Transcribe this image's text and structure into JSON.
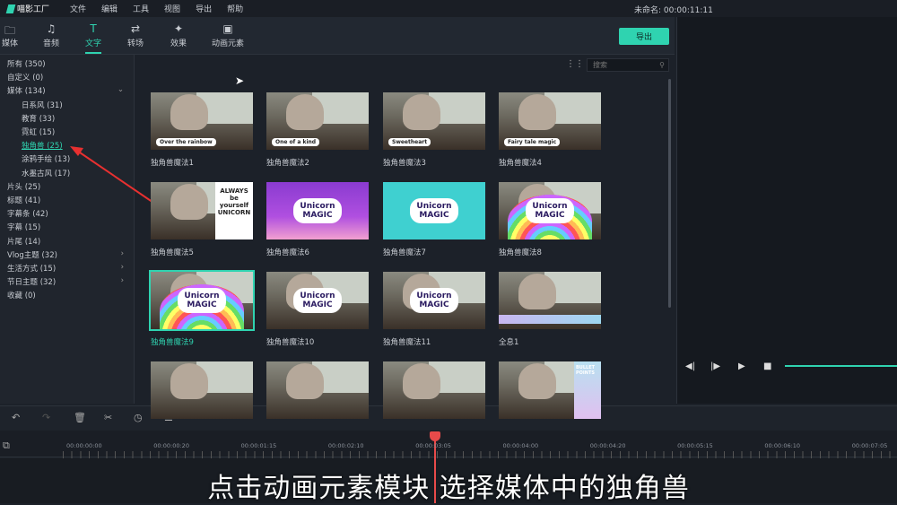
{
  "app": {
    "logo": "喵影工厂",
    "menus": [
      "文件",
      "编辑",
      "工具",
      "视图",
      "导出",
      "帮助"
    ],
    "project": "未命名:",
    "timecode": "00:00:11:11"
  },
  "tabs": [
    {
      "label": "媒体",
      "icon": "folder-icon"
    },
    {
      "label": "音频",
      "icon": "music-icon"
    },
    {
      "label": "文字",
      "icon": "text-icon",
      "active": true
    },
    {
      "label": "转场",
      "icon": "transition-icon"
    },
    {
      "label": "效果",
      "icon": "effects-icon"
    },
    {
      "label": "动画元素",
      "icon": "image-icon"
    }
  ],
  "export_label": "导出",
  "search": {
    "placeholder": "搜索"
  },
  "categories": [
    {
      "label": "所有 (350)"
    },
    {
      "label": "自定义 (0)"
    },
    {
      "label": "媒体 (134)",
      "chevron": "down"
    },
    {
      "label": "日系风 (31)",
      "sub": true
    },
    {
      "label": "教育 (33)",
      "sub": true
    },
    {
      "label": "霓虹 (15)",
      "sub": true
    },
    {
      "label": "独角兽 (25)",
      "sub": true,
      "selected": true
    },
    {
      "label": "涂鸦手绘 (13)",
      "sub": true
    },
    {
      "label": "水墨古风 (17)",
      "sub": true
    },
    {
      "label": "片头 (25)"
    },
    {
      "label": "标题 (41)"
    },
    {
      "label": "字幕条 (42)"
    },
    {
      "label": "字幕 (15)"
    },
    {
      "label": "片尾 (14)"
    },
    {
      "label": "Vlog主题 (32)",
      "chevron": "right"
    },
    {
      "label": "生活方式 (15)",
      "chevron": "right"
    },
    {
      "label": "节日主题 (32)",
      "chevron": "right"
    },
    {
      "label": "收藏 (0)"
    }
  ],
  "items": [
    {
      "label": "独角兽魔法1",
      "overlay": "Over the rainbow"
    },
    {
      "label": "独角兽魔法2",
      "overlay": "One of a kind"
    },
    {
      "label": "独角兽魔法3",
      "overlay": "Sweetheart"
    },
    {
      "label": "独角兽魔法4",
      "overlay": "Fairy tale magic"
    },
    {
      "label": "独角兽魔法5",
      "overlay": "ALWAYS be yourself UNICORN"
    },
    {
      "label": "独角兽魔法6",
      "overlay": "Unicorn MAGIC"
    },
    {
      "label": "独角兽魔法7",
      "overlay": "Unicorn MAGIC"
    },
    {
      "label": "独角兽魔法8",
      "overlay": "Unicorn MAGIC"
    },
    {
      "label": "独角兽魔法9",
      "overlay": "Unicorn MAGIC",
      "selected": true
    },
    {
      "label": "独角兽魔法10",
      "overlay": "Unicorn MAGIC"
    },
    {
      "label": "独角兽魔法11",
      "overlay": "Unicorn MAGIC"
    },
    {
      "label": "全息1",
      "overlay": ""
    },
    {
      "label": "",
      "overlay": ""
    },
    {
      "label": "",
      "overlay": ""
    },
    {
      "label": "",
      "overlay": ""
    },
    {
      "label": "",
      "overlay": "BULLET POINTS"
    }
  ],
  "ruler": [
    "00:00:00:00",
    "00:00:00:20",
    "00:00:01:15",
    "00:00:02:10",
    "00:00:03:05",
    "00:00:04:00",
    "00:00:04:20",
    "00:00:05:15",
    "00:00:06:10",
    "00:00:07:05"
  ],
  "subtitle": "点击动画元素模块  选择媒体中的独角兽",
  "colors": {
    "accent": "#2fd3b0",
    "playhead": "#e84a4a"
  }
}
